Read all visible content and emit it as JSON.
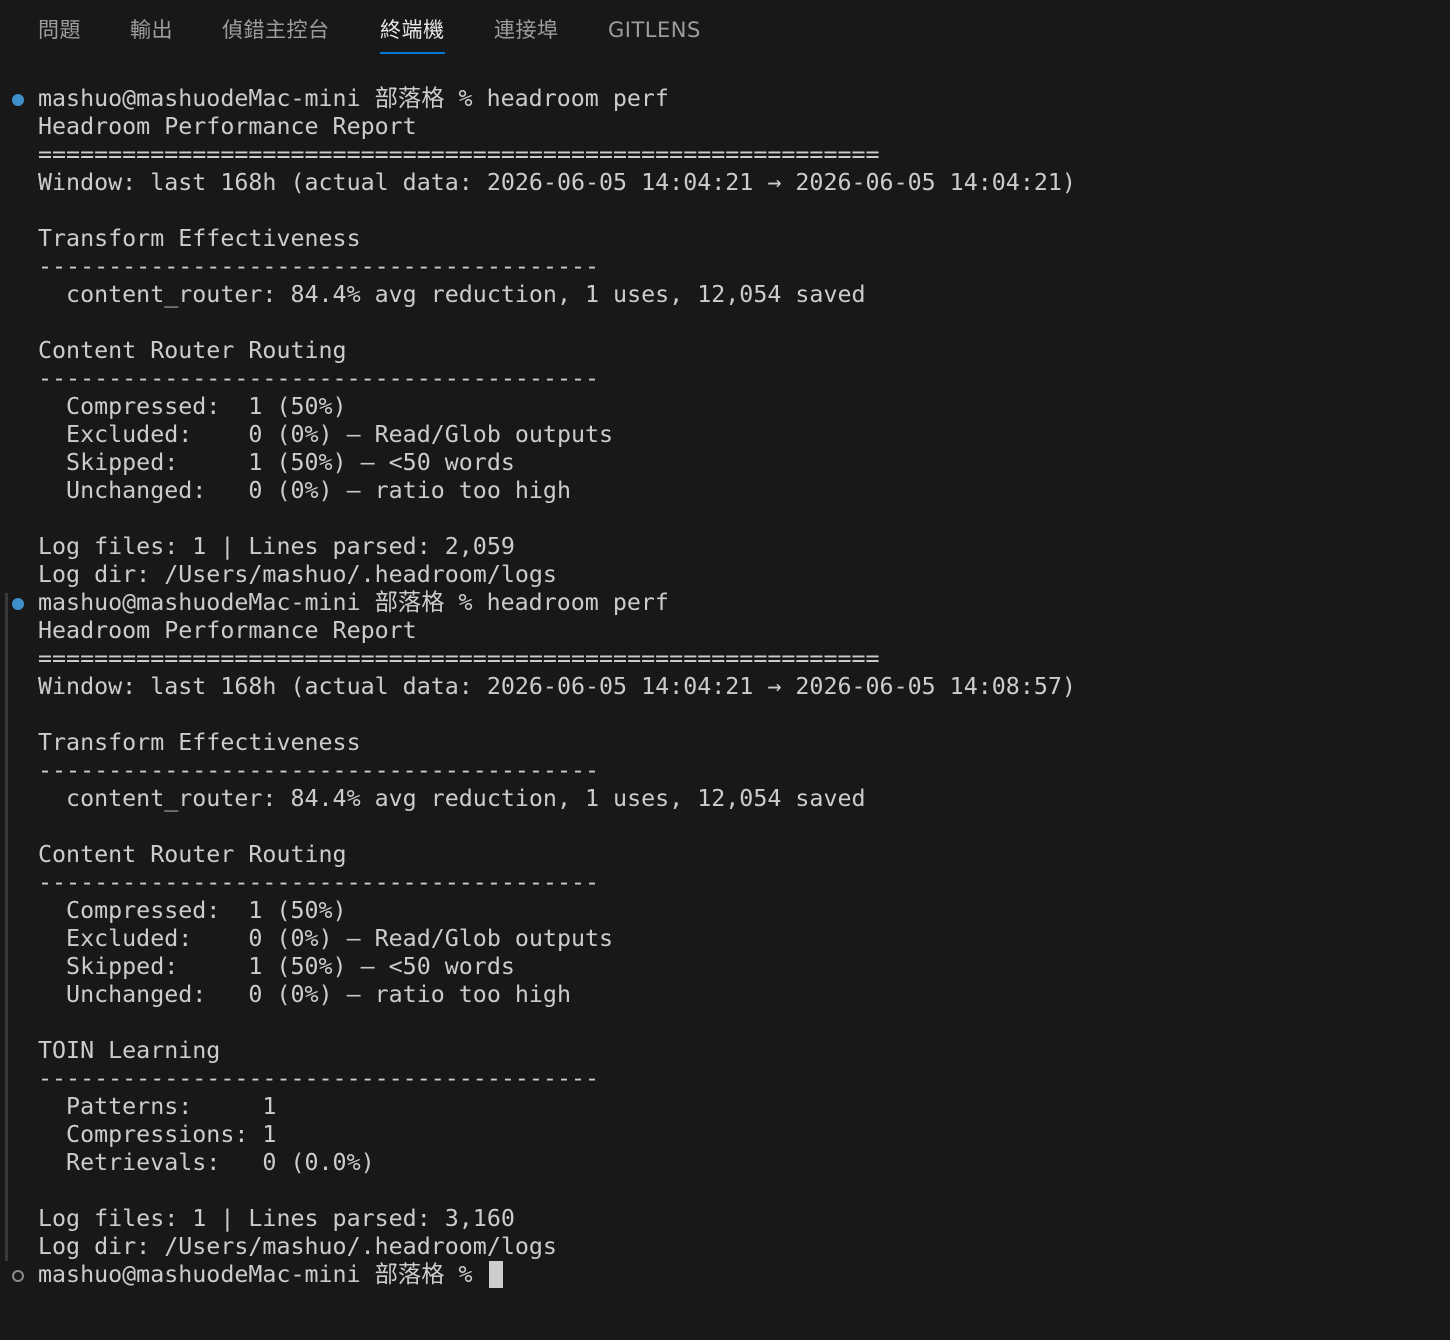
{
  "panel": {
    "tabs": [
      {
        "label": "問題"
      },
      {
        "label": "輸出"
      },
      {
        "label": "偵錯主控台"
      },
      {
        "label": "終端機"
      },
      {
        "label": "連接埠"
      },
      {
        "label": "GITLENS"
      }
    ],
    "active_tab": "終端機"
  },
  "terminal": {
    "lines": [
      "mashuo@mashuodeMac-mini 部落格 % headroom perf",
      "Headroom Performance Report",
      "============================================================",
      "Window: last 168h (actual data: 2026-06-05 14:04:21 → 2026-06-05 14:04:21)",
      "Transform Effectiveness",
      "----------------------------------------",
      "  content_router: 84.4% avg reduction, 1 uses, 12,054 saved",
      "Content Router Routing",
      "----------------------------------------",
      "  Compressed:  1 (50%)",
      "  Excluded:    0 (0%) — Read/Glob outputs",
      "  Skipped:     1 (50%) — <50 words",
      "  Unchanged:   0 (0%) — ratio too high",
      "Log files: 1 | Lines parsed: 2,059",
      "Log dir: /Users/mashuo/.headroom/logs",
      "mashuo@mashuodeMac-mini 部落格 % headroom perf",
      "Headroom Performance Report",
      "============================================================",
      "Window: last 168h (actual data: 2026-06-05 14:04:21 → 2026-06-05 14:08:57)",
      "Transform Effectiveness",
      "----------------------------------------",
      "  content_router: 84.4% avg reduction, 1 uses, 12,054 saved",
      "Content Router Routing",
      "----------------------------------------",
      "  Compressed:  1 (50%)",
      "  Excluded:    0 (0%) — Read/Glob outputs",
      "  Skipped:     1 (50%) — <50 words",
      "  Unchanged:   0 (0%) — ratio too high",
      "TOIN Learning",
      "----------------------------------------",
      "  Patterns:     1",
      "  Compressions: 1",
      "  Retrievals:   0 (0.0%)",
      "Log files: 1 | Lines parsed: 3,160",
      "Log dir: /Users/mashuo/.headroom/logs",
      "mashuo@mashuodeMac-mini 部落格 % "
    ]
  },
  "colors": {
    "background": "#181818",
    "text": "#cccccc",
    "tab_inactive": "#9d9d9d",
    "tab_active": "#e7e7e7",
    "tab_underline": "#0078d4",
    "marker_success": "#3f8fca",
    "marker_pending": "#8b8b8b"
  }
}
